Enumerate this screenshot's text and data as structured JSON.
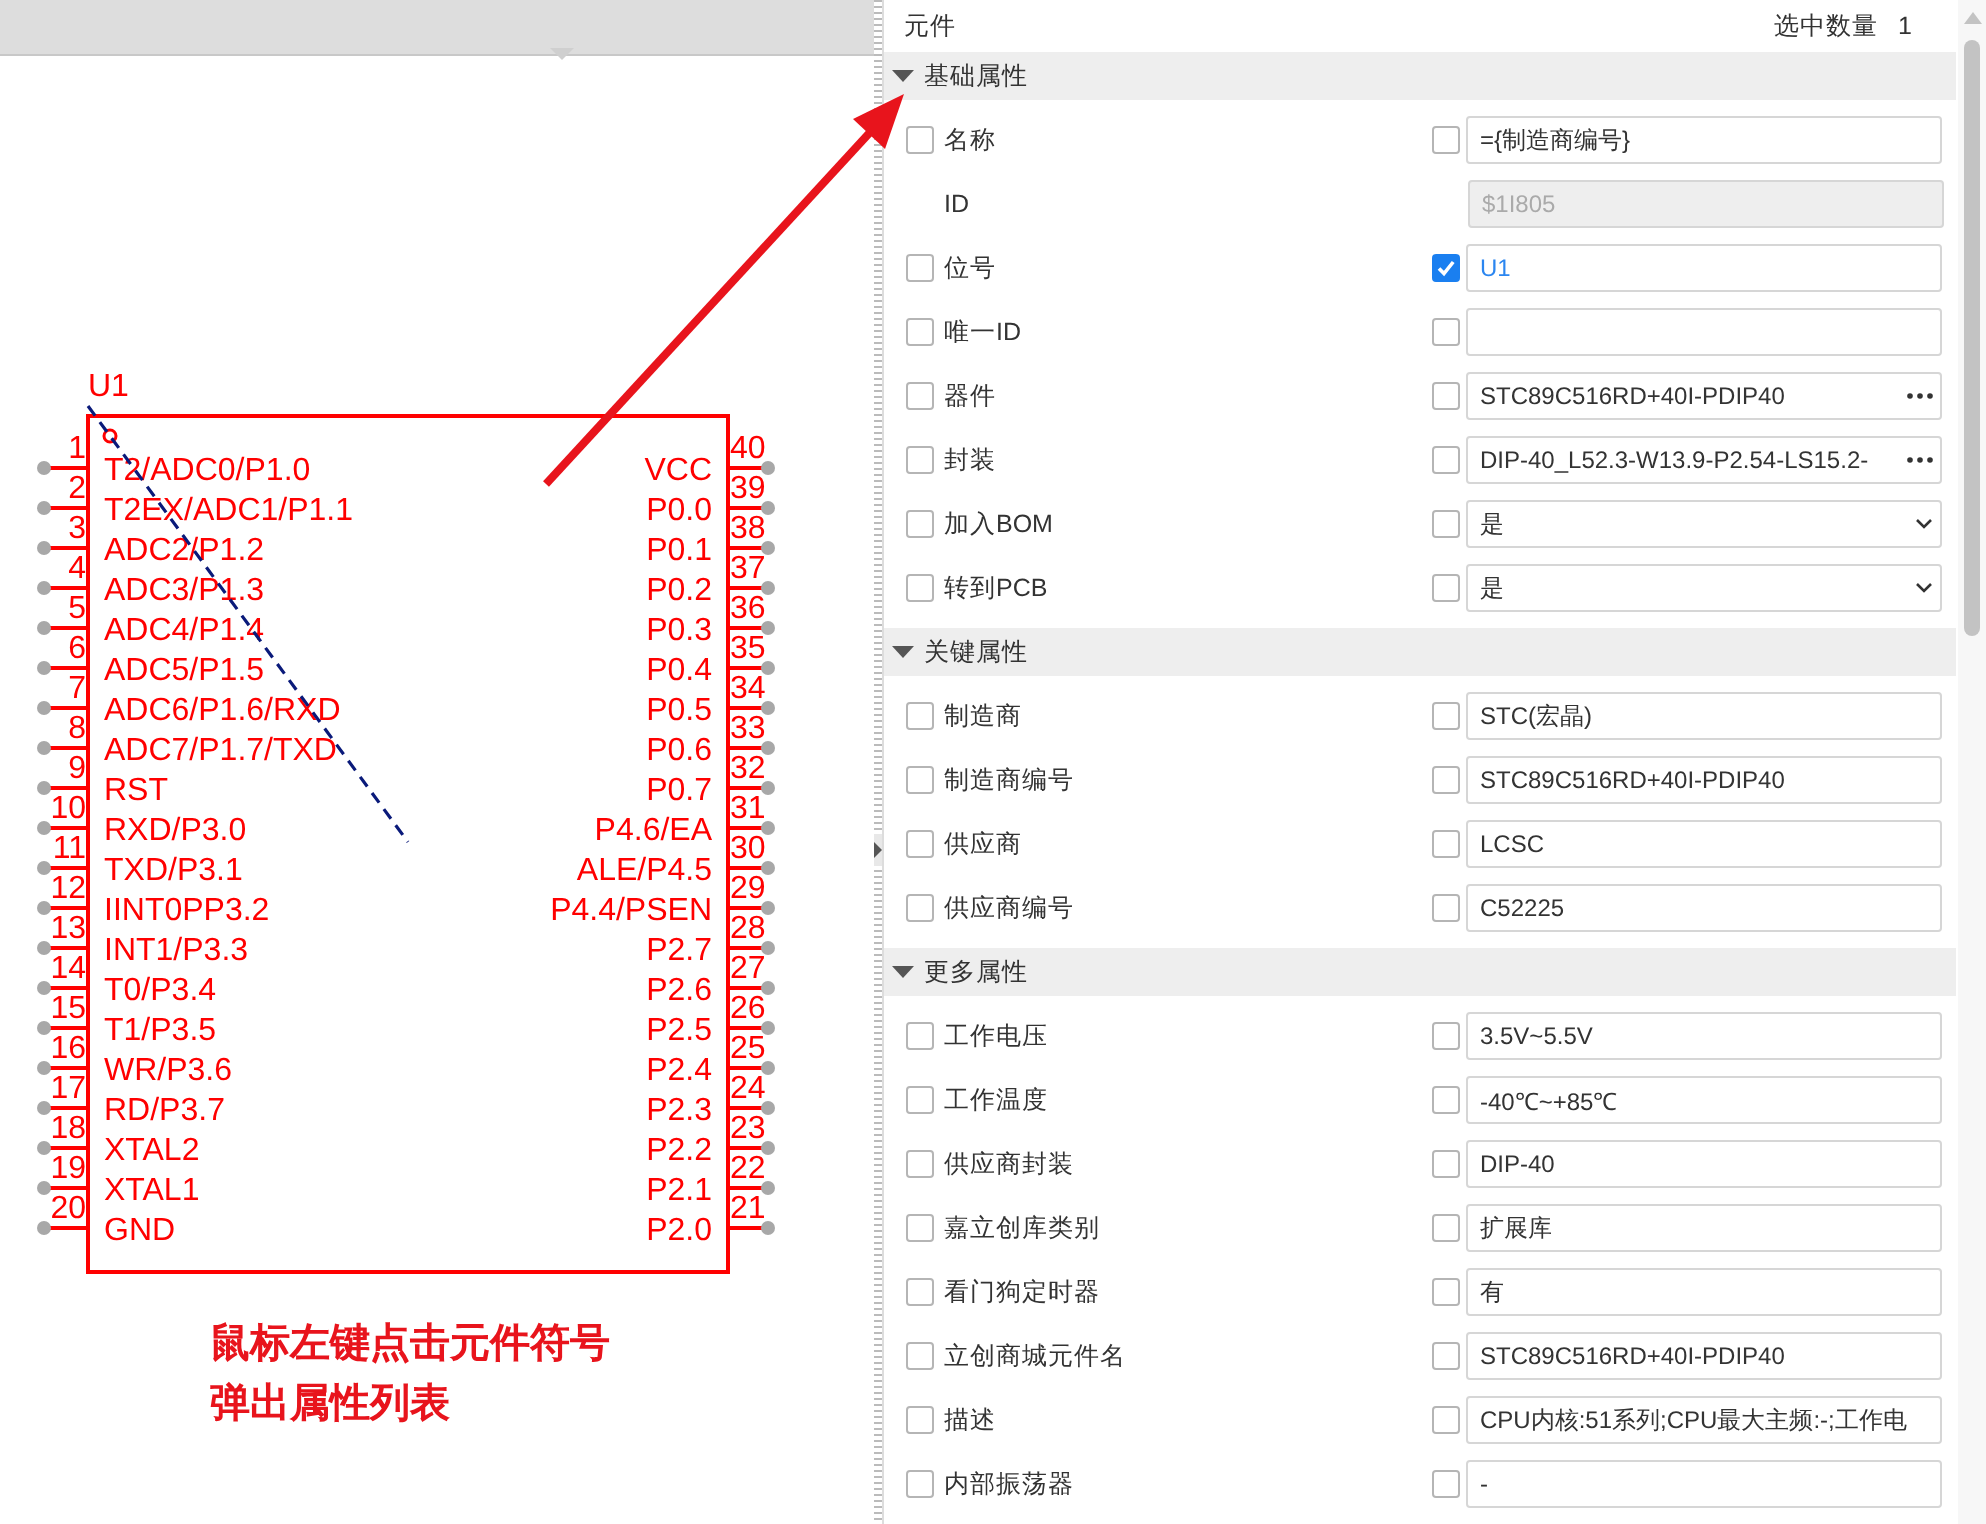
{
  "schematic": {
    "designator": "U1",
    "left_pins": [
      {
        "number": "1",
        "name": "T2/ADC0/P1.0"
      },
      {
        "number": "2",
        "name": "T2EX/ADC1/P1.1"
      },
      {
        "number": "3",
        "name": "ADC2/P1.2"
      },
      {
        "number": "4",
        "name": "ADC3/P1.3"
      },
      {
        "number": "5",
        "name": "ADC4/P1.4"
      },
      {
        "number": "6",
        "name": "ADC5/P1.5"
      },
      {
        "number": "7",
        "name": "ADC6/P1.6/RXD"
      },
      {
        "number": "8",
        "name": "ADC7/P1.7/TXD"
      },
      {
        "number": "9",
        "name": "RST"
      },
      {
        "number": "10",
        "name": "RXD/P3.0"
      },
      {
        "number": "11",
        "name": "TXD/P3.1"
      },
      {
        "number": "12",
        "name": "IINT0PP3.2"
      },
      {
        "number": "13",
        "name": "INT1/P3.3"
      },
      {
        "number": "14",
        "name": "T0/P3.4"
      },
      {
        "number": "15",
        "name": "T1/P3.5"
      },
      {
        "number": "16",
        "name": "WR/P3.6"
      },
      {
        "number": "17",
        "name": "RD/P3.7"
      },
      {
        "number": "18",
        "name": "XTAL2"
      },
      {
        "number": "19",
        "name": "XTAL1"
      },
      {
        "number": "20",
        "name": "GND"
      }
    ],
    "right_pins": [
      {
        "number": "40",
        "name": "VCC"
      },
      {
        "number": "39",
        "name": "P0.0"
      },
      {
        "number": "38",
        "name": "P0.1"
      },
      {
        "number": "37",
        "name": "P0.2"
      },
      {
        "number": "36",
        "name": "P0.3"
      },
      {
        "number": "35",
        "name": "P0.4"
      },
      {
        "number": "34",
        "name": "P0.5"
      },
      {
        "number": "33",
        "name": "P0.6"
      },
      {
        "number": "32",
        "name": "P0.7"
      },
      {
        "number": "31",
        "name": "P4.6/EA"
      },
      {
        "number": "30",
        "name": "ALE/P4.5"
      },
      {
        "number": "29",
        "name": "P4.4/PSEN"
      },
      {
        "number": "28",
        "name": "P2.7"
      },
      {
        "number": "27",
        "name": "P2.6"
      },
      {
        "number": "26",
        "name": "P2.5"
      },
      {
        "number": "25",
        "name": "P2.4"
      },
      {
        "number": "24",
        "name": "P2.3"
      },
      {
        "number": "23",
        "name": "P2.2"
      },
      {
        "number": "22",
        "name": "P2.1"
      },
      {
        "number": "21",
        "name": "P2.0"
      }
    ]
  },
  "annotation": {
    "lines": [
      "鼠标左键点击元件符号",
      "弹出属性列表"
    ]
  },
  "panel": {
    "title": "元件",
    "count_label": "选中数量",
    "count": "1",
    "sections": [
      {
        "title": "基础属性",
        "expanded": true,
        "rows": [
          {
            "label": "名称",
            "kind": "text",
            "label_checked": false,
            "value_checked": false,
            "value": "={制造商编号}"
          },
          {
            "label": "ID",
            "kind": "readonly",
            "value": "$1I805"
          },
          {
            "label": "位号",
            "kind": "text",
            "label_checked": false,
            "value_checked": true,
            "value": "U1"
          },
          {
            "label": "唯一ID",
            "kind": "text",
            "label_checked": false,
            "value_checked": false
          },
          {
            "label": "器件",
            "kind": "picker",
            "label_checked": false,
            "value_checked": false,
            "value": "STC89C516RD+40I-PDIP40"
          },
          {
            "label": "封装",
            "kind": "picker",
            "label_checked": false,
            "value_checked": false,
            "value": "DIP-40_L52.3-W13.9-P2.54-LS15.2-"
          },
          {
            "label": "加入BOM",
            "kind": "select",
            "label_checked": false,
            "value_checked": false,
            "value": "是"
          },
          {
            "label": "转到PCB",
            "kind": "select",
            "label_checked": false,
            "value_checked": false,
            "value": "是"
          }
        ]
      },
      {
        "title": "关键属性",
        "expanded": true,
        "rows": [
          {
            "label": "制造商",
            "kind": "text",
            "label_checked": false,
            "value_checked": false,
            "value": "STC(宏晶)"
          },
          {
            "label": "制造商编号",
            "kind": "text",
            "label_checked": false,
            "value_checked": false,
            "value": "STC89C516RD+40I-PDIP40"
          },
          {
            "label": "供应商",
            "kind": "text",
            "label_checked": false,
            "value_checked": false,
            "value": "LCSC"
          },
          {
            "label": "供应商编号",
            "kind": "text",
            "label_checked": false,
            "value_checked": false,
            "value": "C52225"
          }
        ]
      },
      {
        "title": "更多属性",
        "expanded": true,
        "rows": [
          {
            "label": "工作电压",
            "kind": "text",
            "label_checked": false,
            "value_checked": false,
            "value": "3.5V~5.5V"
          },
          {
            "label": "工作温度",
            "kind": "text",
            "label_checked": false,
            "value_checked": false,
            "value": "-40℃~+85℃"
          },
          {
            "label": "供应商封装",
            "kind": "text",
            "label_checked": false,
            "value_checked": false,
            "value": "DIP-40"
          },
          {
            "label": "嘉立创库类别",
            "kind": "text",
            "label_checked": false,
            "value_checked": false,
            "value": "扩展库"
          },
          {
            "label": "看门狗定时器",
            "kind": "text",
            "label_checked": false,
            "value_checked": false,
            "value": "有"
          },
          {
            "label": "立创商城元件名",
            "kind": "text",
            "label_checked": false,
            "value_checked": false,
            "value": "STC89C516RD+40I-PDIP40"
          },
          {
            "label": "描述",
            "kind": "text",
            "label_checked": false,
            "value_checked": false,
            "value": "CPU内核:51系列;CPU最大主频:-;工作电"
          },
          {
            "label": "内部振荡器",
            "kind": "text",
            "label_checked": false,
            "value_checked": false,
            "value": "-"
          }
        ]
      }
    ]
  }
}
